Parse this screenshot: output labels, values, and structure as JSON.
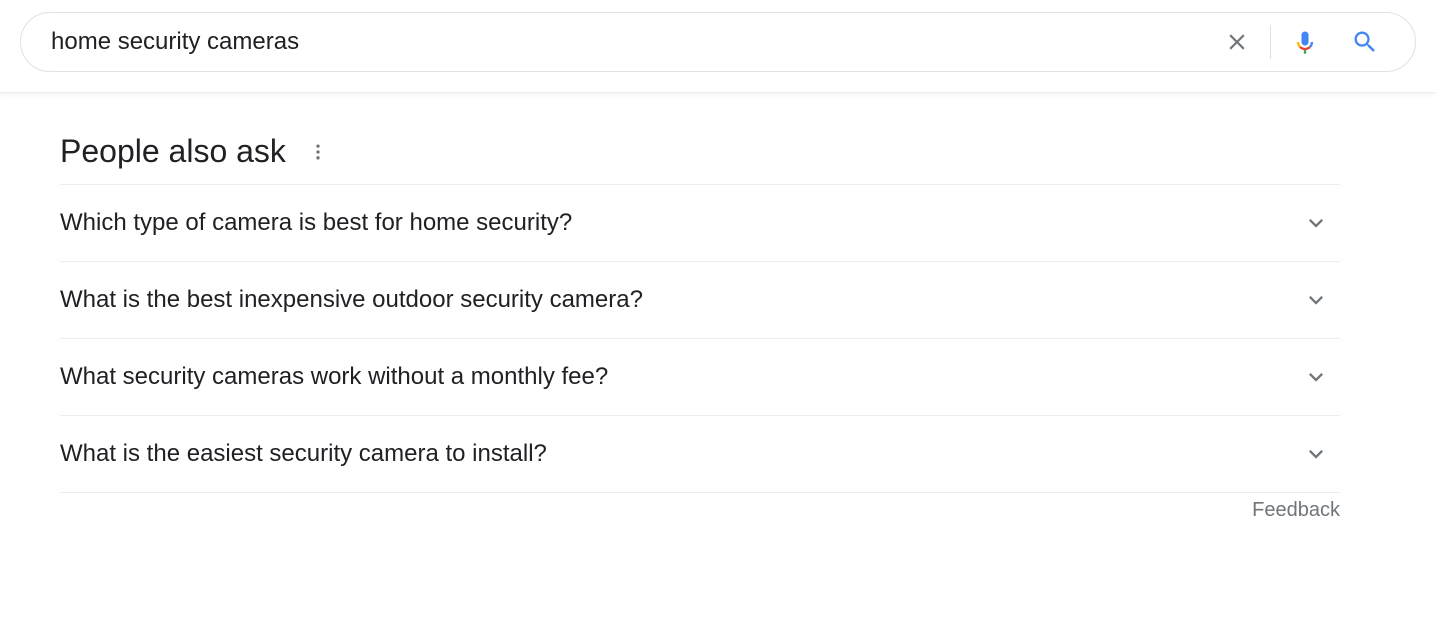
{
  "search": {
    "query": "home security cameras"
  },
  "paa": {
    "heading": "People also ask",
    "questions": [
      "Which type of camera is best for home security?",
      "What is the best inexpensive outdoor security camera?",
      "What security cameras work without a monthly fee?",
      "What is the easiest security camera to install?"
    ],
    "feedback_label": "Feedback"
  }
}
